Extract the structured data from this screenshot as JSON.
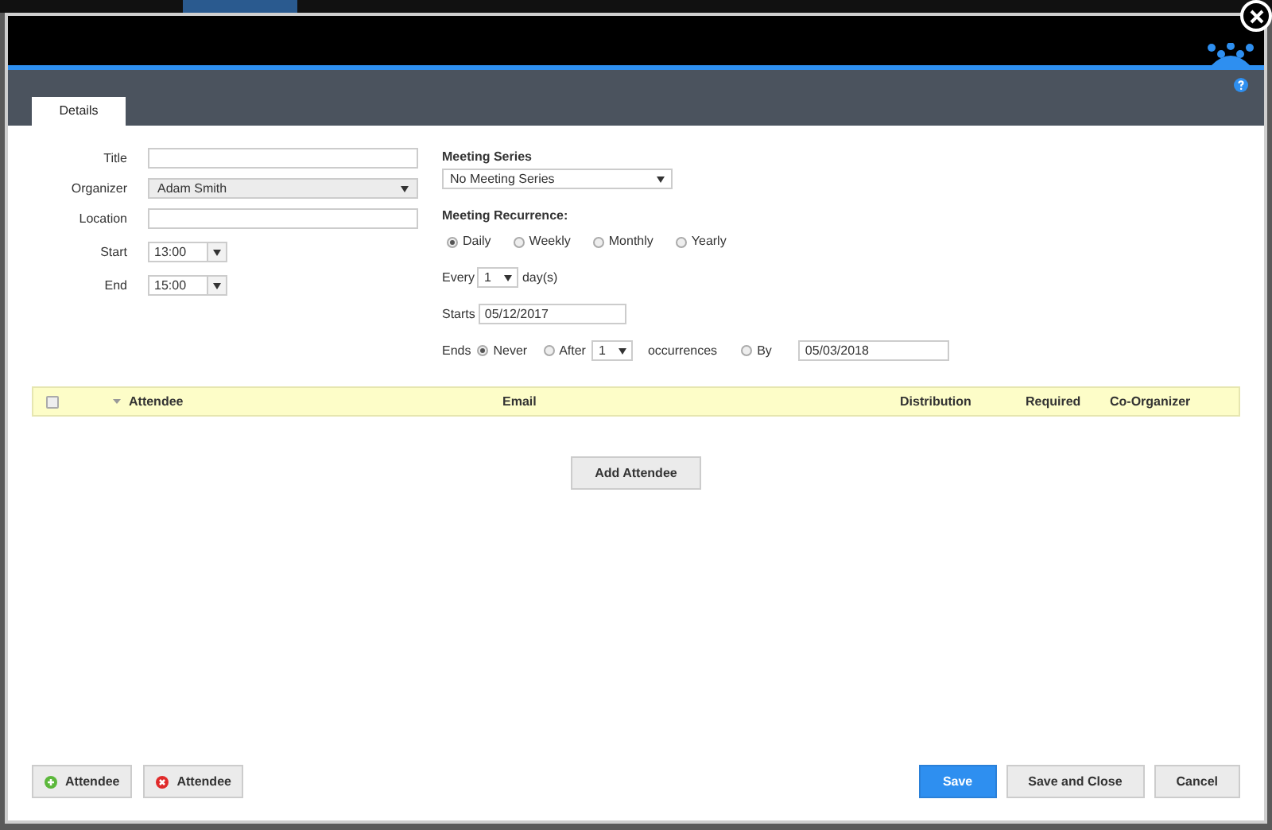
{
  "tabs": [
    {
      "label": "Details",
      "selected": true
    }
  ],
  "fields": [
    {
      "label": "Title",
      "kind": "text"
    },
    {
      "label": "Organizer",
      "kind": "select",
      "value": "Adam Smith"
    },
    {
      "label": "Location",
      "kind": "text"
    },
    {
      "label": "Start",
      "kind": "time",
      "value": "13:00"
    },
    {
      "label": "End",
      "kind": "time",
      "value": "15:00"
    }
  ],
  "meeting_series": {
    "label": "Meeting Series",
    "value": "No Meeting Series"
  },
  "recurrence": {
    "label": "Meeting Recurrence:",
    "options": [
      {
        "label": "Daily",
        "selected": true
      },
      {
        "label": "Weekly",
        "selected": false
      },
      {
        "label": "Monthly",
        "selected": false
      },
      {
        "label": "Yearly",
        "selected": false
      }
    ],
    "every": {
      "label": "Every",
      "value": "1",
      "unit": "day(s)"
    },
    "starts": {
      "label": "Starts",
      "value": "05/12/2017"
    },
    "ends": {
      "label": "Ends",
      "options": [
        {
          "label": "Never",
          "selected": true
        },
        {
          "label": "After",
          "selected": false
        },
        {
          "label": "By",
          "selected": false
        }
      ],
      "after_value": "1",
      "after_unit": "occurrences",
      "by_value": "05/03/2018"
    }
  },
  "table": {
    "select_all_checked": false,
    "columns": [
      "Attendee",
      "Email",
      "Distribution",
      "Required",
      "Co-Organizer"
    ]
  },
  "add_button": "Add Attendee",
  "footer": {
    "left": [
      {
        "label": "Attendee",
        "kind": "add"
      },
      {
        "label": "Attendee",
        "kind": "remove"
      }
    ],
    "right": [
      {
        "label": "Save",
        "kind": "primary"
      },
      {
        "label": "Save and Close",
        "kind": "secondary"
      },
      {
        "label": "Cancel",
        "kind": "secondary"
      }
    ]
  }
}
